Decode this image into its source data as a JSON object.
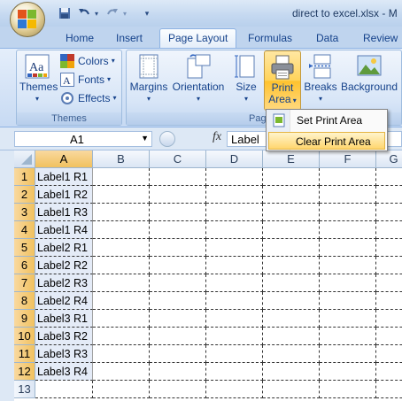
{
  "title_bar": {
    "window_title": "direct to excel.xlsx - M"
  },
  "tabs": [
    {
      "label": "Home"
    },
    {
      "label": "Insert"
    },
    {
      "label": "Page Layout",
      "active": true
    },
    {
      "label": "Formulas"
    },
    {
      "label": "Data"
    },
    {
      "label": "Review"
    }
  ],
  "ribbon": {
    "themes_group": {
      "label": "Themes",
      "themes_button": "Themes",
      "colors_button": "Colors",
      "fonts_button": "Fonts",
      "effects_button": "Effects"
    },
    "page_setup_group": {
      "label": "Pag",
      "margins": "Margins",
      "orientation": "Orientation",
      "size": "Size",
      "print_area_line1": "Print",
      "print_area_line2": "Area",
      "breaks": "Breaks",
      "background": "Background"
    }
  },
  "print_area_menu": {
    "items": [
      {
        "label": "Set Print Area"
      },
      {
        "label": "Clear Print Area",
        "hovered": true
      }
    ]
  },
  "formula_bar": {
    "name_box": "A1",
    "fx_label": "fx",
    "formula_value": "Label"
  },
  "sheet": {
    "columns": [
      "A",
      "B",
      "C",
      "D",
      "E",
      "F",
      "G"
    ],
    "rows": [
      {
        "num": "1",
        "a": "Label1 R1"
      },
      {
        "num": "2",
        "a": "Label1 R2"
      },
      {
        "num": "3",
        "a": "Label1 R3"
      },
      {
        "num": "4",
        "a": "Label1 R4"
      },
      {
        "num": "5",
        "a": "Label2 R1"
      },
      {
        "num": "6",
        "a": "Label2 R2"
      },
      {
        "num": "7",
        "a": "Label2 R3"
      },
      {
        "num": "8",
        "a": "Label2 R4"
      },
      {
        "num": "9",
        "a": "Label3 R1"
      },
      {
        "num": "10",
        "a": "Label3 R2"
      },
      {
        "num": "11",
        "a": "Label3 R3"
      },
      {
        "num": "12",
        "a": "Label3 R4"
      },
      {
        "num": "13",
        "a": ""
      }
    ]
  }
}
